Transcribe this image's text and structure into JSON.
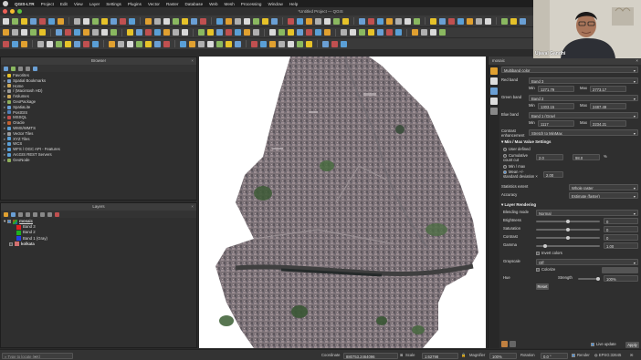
{
  "menubar": {
    "app": "QGIS-LTR",
    "items": [
      "Project",
      "Edit",
      "View",
      "Layer",
      "Settings",
      "Plugins",
      "Vector",
      "Raster",
      "Database",
      "Web",
      "Mesh",
      "Processing",
      "Window",
      "Help"
    ]
  },
  "window": {
    "title": "*Untitled Project — QGIS"
  },
  "browser": {
    "title": "Browser",
    "items": [
      {
        "label": "Favorites",
        "icon": "star-icon",
        "color": "#e6c229"
      },
      {
        "label": "Spatial Bookmarks",
        "icon": "bookmark-icon",
        "color": "#7a9cc6"
      },
      {
        "label": "Home",
        "icon": "folder-icon",
        "color": "#c9a75a"
      },
      {
        "label": "/ (Macintosh HD)",
        "icon": "drive-icon",
        "color": "#999999"
      },
      {
        "label": "/Volumes",
        "icon": "folder-icon",
        "color": "#c9a75a"
      },
      {
        "label": "GeoPackage",
        "icon": "geopackage-icon",
        "color": "#8fb05a"
      },
      {
        "label": "SpatiaLite",
        "icon": "spatialite-icon",
        "color": "#6aa0d6"
      },
      {
        "label": "PostGIS",
        "icon": "postgis-icon",
        "color": "#4f7fb8"
      },
      {
        "label": "MSSQL",
        "icon": "mssql-icon",
        "color": "#c05050"
      },
      {
        "label": "Oracle",
        "icon": "oracle-icon",
        "color": "#c06030"
      },
      {
        "label": "WMS/WMTS",
        "icon": "globe-icon",
        "color": "#5a9fd6"
      },
      {
        "label": "Vector Tiles",
        "icon": "vector-tiles-icon",
        "color": "#9a9a9a"
      },
      {
        "label": "XYZ Tiles",
        "icon": "xyz-tiles-icon",
        "color": "#5a9fd6"
      },
      {
        "label": "WCS",
        "icon": "globe-icon",
        "color": "#5a9fd6"
      },
      {
        "label": "WFS / OGC API - Features",
        "icon": "globe-icon",
        "color": "#5a9fd6"
      },
      {
        "label": "ArcGIS REST Servers",
        "icon": "arcgis-icon",
        "color": "#5a9fd6"
      },
      {
        "label": "GeoNode",
        "icon": "geonode-icon",
        "color": "#8fb05a"
      }
    ]
  },
  "layers": {
    "title": "Layers",
    "items": [
      {
        "label": "mosaic",
        "kind": "group",
        "checked": true
      },
      {
        "label": "Band 3",
        "kind": "band",
        "color": "#e02020"
      },
      {
        "label": "Band 2",
        "kind": "band",
        "color": "#20b020"
      },
      {
        "label": "Band 1 (Gray)",
        "kind": "band",
        "color": "#2040e0"
      },
      {
        "label": "kolkata",
        "kind": "layer",
        "checked": false
      }
    ]
  },
  "symbology": {
    "panel_title": "mosaic",
    "render_type": "Multiband color",
    "red_band": {
      "label": "Red band",
      "value": "Band 3",
      "min_label": "Min",
      "min": "1271.79",
      "max_label": "Max",
      "max": "2773.17"
    },
    "green_band": {
      "label": "Green band",
      "value": "Band 2",
      "min_label": "Min",
      "min": "1303.15",
      "max_label": "Max",
      "max": "2487.49"
    },
    "blue_band": {
      "label": "Blue band",
      "value": "Band 1 (Gray)",
      "min_label": "Min",
      "min": "1117",
      "max_label": "Max",
      "max": "2234.21"
    },
    "contrast_label": "Contrast enhancement",
    "contrast": "Stretch to MinMax",
    "minmax_title": "Min / Max Value Settings",
    "radios": [
      "User defined",
      "Cumulative count cut",
      "Min / max",
      "Mean +/- standard deviation ×"
    ],
    "cum_low": "2.0",
    "cum_high": "98.0",
    "cum_unit": "%",
    "std": "2.00",
    "extent_label": "Statistics extent",
    "extent": "Whole raster",
    "accuracy_label": "Accuracy",
    "accuracy": "Estimate (faster)",
    "rendering_title": "Layer Rendering",
    "blend_label": "Blending mode",
    "blend": "Normal",
    "brightness_label": "Brightness",
    "brightness": "0",
    "saturation_label": "Saturation",
    "saturation": "0",
    "contrast2_label": "Contrast",
    "contrast2": "0",
    "gamma_label": "Gamma",
    "gamma": "1.00",
    "invert_label": "Invert colors",
    "grayscale_label": "Grayscale",
    "grayscale": "Off",
    "colorize_label": "Colorize",
    "hue_label": "Hue",
    "strength_label": "Strength",
    "strength": "100%",
    "reset_label": "Reset",
    "live_update_label": "Live update",
    "apply_label": "Apply"
  },
  "statusbar": {
    "locate_placeholder": "Type to locate (⌘K)",
    "coordinate_label": "Coordinate",
    "coordinate": "880753,2464096",
    "scale_label": "Scale",
    "scale": "1:62798",
    "magnifier_label": "Magnifier",
    "magnifier": "100%",
    "rotation_label": "Rotation",
    "rotation": "0.0 °",
    "render_label": "Render",
    "crs": "EPSG:32645"
  },
  "webcam": {
    "name": "Ujaval Gandhi"
  }
}
